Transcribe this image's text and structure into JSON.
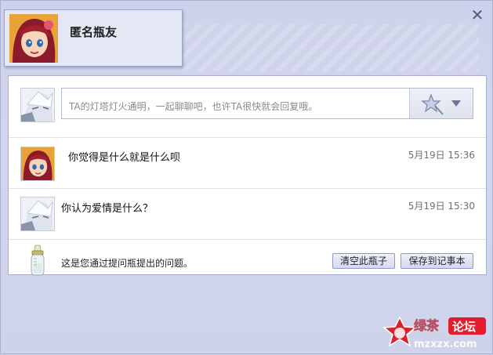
{
  "window": {
    "close_label": "✕"
  },
  "header": {
    "name": "匿名瓶友",
    "avatar_icon": "cartoon-girl-avatar"
  },
  "compose": {
    "placeholder": "TA的灯塔灯火通明，一起聊聊吧，也许TA很快就会回复哦。",
    "emote_icon": "magic-wand-icon",
    "dropdown_icon": "chevron-down-icon"
  },
  "messages": [
    {
      "text": "你觉得是什么就是什么呗",
      "time": "5月19日 15:36",
      "avatar_icon": "cartoon-girl-avatar"
    },
    {
      "text": "你认为爱情是什么？",
      "time": "5月19日 15:30",
      "avatar_icon": "anime-boy-avatar"
    }
  ],
  "footer": {
    "text": "这是您通过提问瓶提出的问题。",
    "clear_label": "清空此瓶子",
    "save_label": "保存到记事本",
    "bottle_icon": "baby-bottle-icon"
  },
  "watermark": {
    "text": "论坛",
    "site": "mzxzx.com"
  },
  "colors": {
    "accent": "#5a6aa8",
    "panel_bg": "#ffffff",
    "page_bg": "#cdd2ea"
  }
}
